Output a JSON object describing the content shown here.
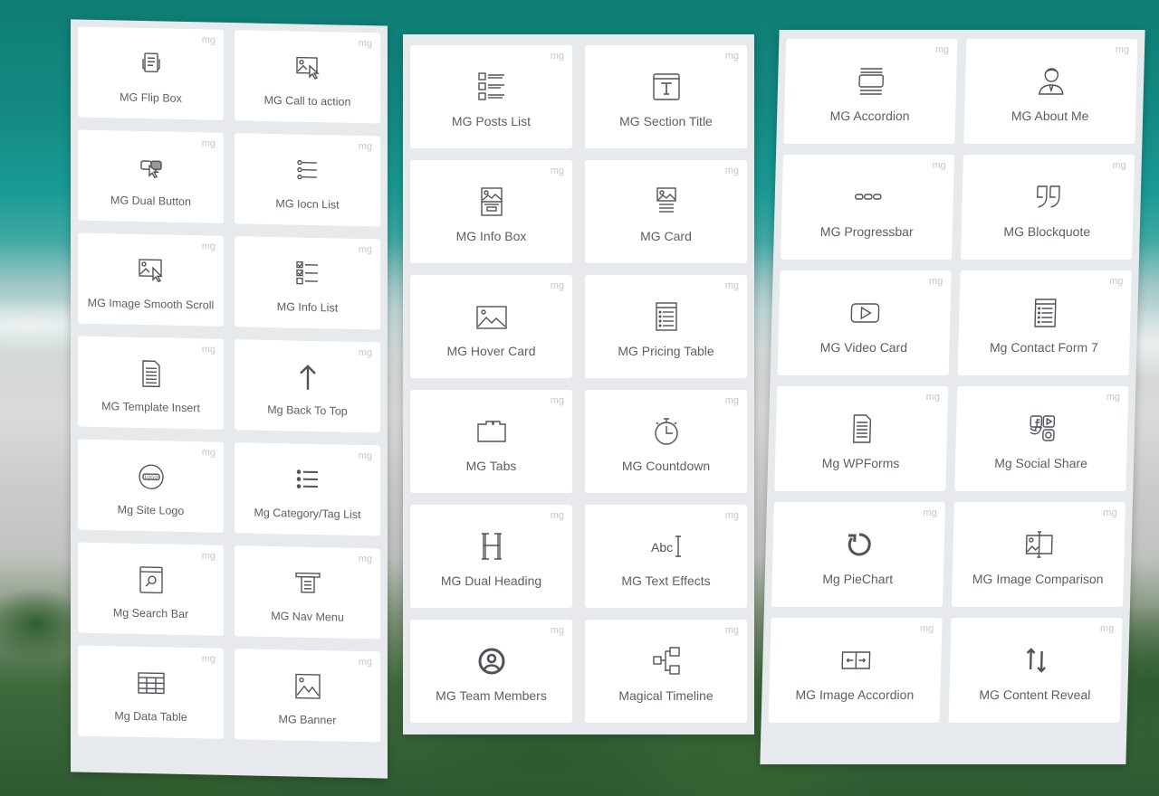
{
  "mg_badge": "mg",
  "panels": {
    "left": [
      {
        "label": "MG Flip Box",
        "icon": "flip-box-icon"
      },
      {
        "label": "MG Call to action",
        "icon": "call-to-action-icon"
      },
      {
        "label": "MG Dual Button",
        "icon": "dual-button-icon"
      },
      {
        "label": "MG Iocn List",
        "icon": "icon-list-icon"
      },
      {
        "label": "MG Image Smooth Scroll",
        "icon": "image-smooth-scroll-icon"
      },
      {
        "label": "MG Info List",
        "icon": "info-list-icon"
      },
      {
        "label": "MG Template Insert",
        "icon": "template-insert-icon"
      },
      {
        "label": "Mg Back To Top",
        "icon": "arrow-up-icon"
      },
      {
        "label": "Mg Site Logo",
        "icon": "site-logo-icon"
      },
      {
        "label": "Mg Category/Tag List",
        "icon": "category-list-icon"
      },
      {
        "label": "Mg Search Bar",
        "icon": "search-bar-icon"
      },
      {
        "label": "MG Nav Menu",
        "icon": "nav-menu-icon"
      },
      {
        "label": "Mg Data Table",
        "icon": "data-table-icon"
      },
      {
        "label": "MG Banner",
        "icon": "banner-image-icon"
      }
    ],
    "middle": [
      {
        "label": "MG Posts List",
        "icon": "posts-list-icon"
      },
      {
        "label": "MG Section Title",
        "icon": "section-title-icon"
      },
      {
        "label": "MG Info Box",
        "icon": "info-box-icon"
      },
      {
        "label": "MG Card",
        "icon": "card-icon"
      },
      {
        "label": "MG Hover Card",
        "icon": "hover-card-image-icon"
      },
      {
        "label": "MG Pricing Table",
        "icon": "pricing-table-icon"
      },
      {
        "label": "MG Tabs",
        "icon": "tabs-folder-icon"
      },
      {
        "label": "MG Countdown",
        "icon": "stopwatch-icon"
      },
      {
        "label": "MG Dual Heading",
        "icon": "heading-h-icon"
      },
      {
        "label": "MG Text Effects",
        "icon": "text-effects-icon"
      },
      {
        "label": "MG Team Members",
        "icon": "team-member-icon"
      },
      {
        "label": "Magical Timeline",
        "icon": "timeline-icon"
      }
    ],
    "right": [
      {
        "label": "MG Accordion",
        "icon": "accordion-icon"
      },
      {
        "label": "MG About Me",
        "icon": "about-me-person-icon"
      },
      {
        "label": "MG Progressbar",
        "icon": "progressbar-icon"
      },
      {
        "label": "MG Blockquote",
        "icon": "blockquote-icon"
      },
      {
        "label": "MG Video Card",
        "icon": "video-play-icon"
      },
      {
        "label": "Mg Contact Form 7",
        "icon": "contact-form-icon"
      },
      {
        "label": "Mg WPForms",
        "icon": "wpforms-document-icon"
      },
      {
        "label": "Mg Social Share",
        "icon": "social-share-icon"
      },
      {
        "label": "Mg PieChart",
        "icon": "pie-chart-refresh-icon"
      },
      {
        "label": "MG Image Comparison",
        "icon": "image-comparison-icon"
      },
      {
        "label": "MG Image Accordion",
        "icon": "image-accordion-icon"
      },
      {
        "label": "MG Content Reveal",
        "icon": "content-reveal-arrows-icon"
      }
    ]
  }
}
